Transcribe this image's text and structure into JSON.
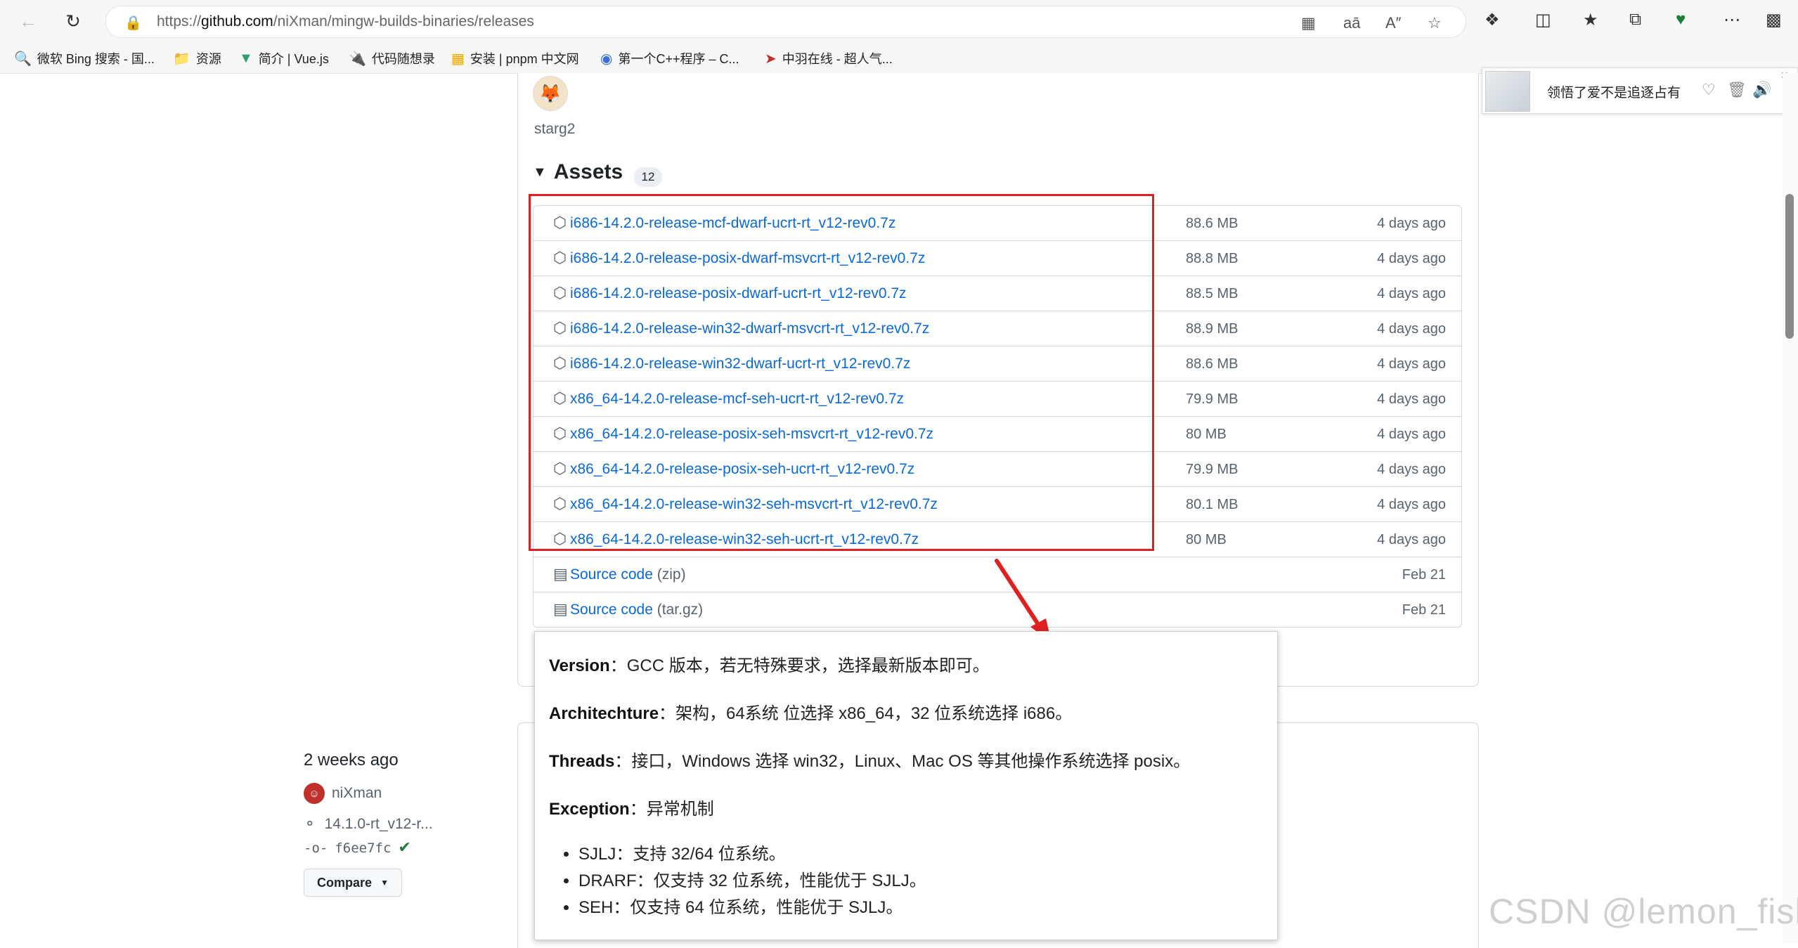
{
  "browser": {
    "url_prefix": "https://",
    "url_domain": "github.com",
    "url_path": "/niXman/mingw-builds-binaries/releases"
  },
  "bookmarks": [
    {
      "label": "微软 Bing 搜索 - 国...",
      "icon": "search-icon"
    },
    {
      "label": "资源",
      "icon": "folder-icon"
    },
    {
      "label": "简介 | Vue.js",
      "icon": "vue-icon"
    },
    {
      "label": "代码随想录",
      "icon": "code-icon"
    },
    {
      "label": "安装 | pnpm 中文网",
      "icon": "pnpm-icon"
    },
    {
      "label": "第一个C++程序 – C...",
      "icon": "c-icon"
    },
    {
      "label": "中羽在线 - 超人气...",
      "icon": "badminton-icon"
    }
  ],
  "release": {
    "author": "starg2",
    "assets_title": "Assets",
    "assets_count": "12",
    "assets": [
      {
        "name": "i686-14.2.0-release-mcf-dwarf-ucrt-rt_v12-rev0.7z",
        "size": "88.6 MB",
        "date": "4 days ago"
      },
      {
        "name": "i686-14.2.0-release-posix-dwarf-msvcrt-rt_v12-rev0.7z",
        "size": "88.8 MB",
        "date": "4 days ago"
      },
      {
        "name": "i686-14.2.0-release-posix-dwarf-ucrt-rt_v12-rev0.7z",
        "size": "88.5 MB",
        "date": "4 days ago"
      },
      {
        "name": "i686-14.2.0-release-win32-dwarf-msvcrt-rt_v12-rev0.7z",
        "size": "88.9 MB",
        "date": "4 days ago"
      },
      {
        "name": "i686-14.2.0-release-win32-dwarf-ucrt-rt_v12-rev0.7z",
        "size": "88.6 MB",
        "date": "4 days ago"
      },
      {
        "name": "x86_64-14.2.0-release-mcf-seh-ucrt-rt_v12-rev0.7z",
        "size": "79.9 MB",
        "date": "4 days ago"
      },
      {
        "name": "x86_64-14.2.0-release-posix-seh-msvcrt-rt_v12-rev0.7z",
        "size": "80 MB",
        "date": "4 days ago"
      },
      {
        "name": "x86_64-14.2.0-release-posix-seh-ucrt-rt_v12-rev0.7z",
        "size": "79.9 MB",
        "date": "4 days ago"
      },
      {
        "name": "x86_64-14.2.0-release-win32-seh-msvcrt-rt_v12-rev0.7z",
        "size": "80.1 MB",
        "date": "4 days ago"
      },
      {
        "name": "x86_64-14.2.0-release-win32-seh-ucrt-rt_v12-rev0.7z",
        "size": "80 MB",
        "date": "4 days ago"
      }
    ],
    "source": [
      {
        "name": "Source code",
        "suffix": "(zip)",
        "date": "Feb 21"
      },
      {
        "name": "Source code",
        "suffix": "(tar.gz)",
        "date": "Feb 21"
      }
    ]
  },
  "note": {
    "lines": [
      {
        "term": "Version",
        "text": "：GCC 版本，若无特殊要求，选择最新版本即可。"
      },
      {
        "term": "Architechture",
        "text": "：架构，64系统 位选择 x86_64，32 位系统选择 i686。"
      },
      {
        "term": "Threads",
        "text": "：接口，Windows 选择 win32，Linux、Mac OS 等其他操作系统选择 posix。"
      },
      {
        "term": "Exception",
        "text": "：异常机制"
      }
    ],
    "bullets": [
      "SJLJ：支持 32/64 位系统。",
      "DRARF：仅支持 32 位系统，性能优于 SJLJ。",
      "SEH：仅支持 64 位系统，性能优于 SJLJ。"
    ]
  },
  "sidebar": {
    "when": "2 weeks ago",
    "author": "niXman",
    "tag": "14.1.0-rt_v12-r...",
    "commit": "f6ee7fc",
    "compare_label": "Compare"
  },
  "popup": {
    "title": "领悟了爱不是追逐占有"
  },
  "watermark": "CSDN @lemon_fish",
  "colors": {
    "link": "#0969da",
    "highlight": "#e02020",
    "success": "#1a7f37"
  }
}
